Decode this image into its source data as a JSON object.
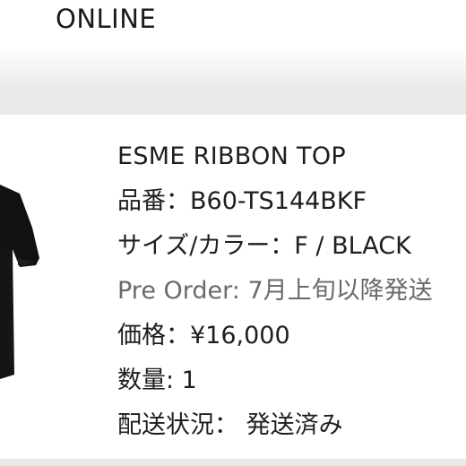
{
  "header": {
    "store_name": "ONLINE"
  },
  "product": {
    "name": "ESME RIBBON TOP",
    "item_number": "品番：B60-TS144BKF",
    "size_color": "サイズ/カラー：F / BLACK",
    "pre_order": "Pre Order: 7月上旬以降発送",
    "price": "価格：¥16,000",
    "quantity": "数量: 1",
    "shipping_status": "配送状況：  発送済み",
    "thumbnail_icon": "black-top-garment-image"
  },
  "colors": {
    "background": "#ffffff",
    "band": "#e9e9e9",
    "text": "#1e1e1e",
    "muted_text": "#6a6a6a",
    "garment": "#111111"
  }
}
